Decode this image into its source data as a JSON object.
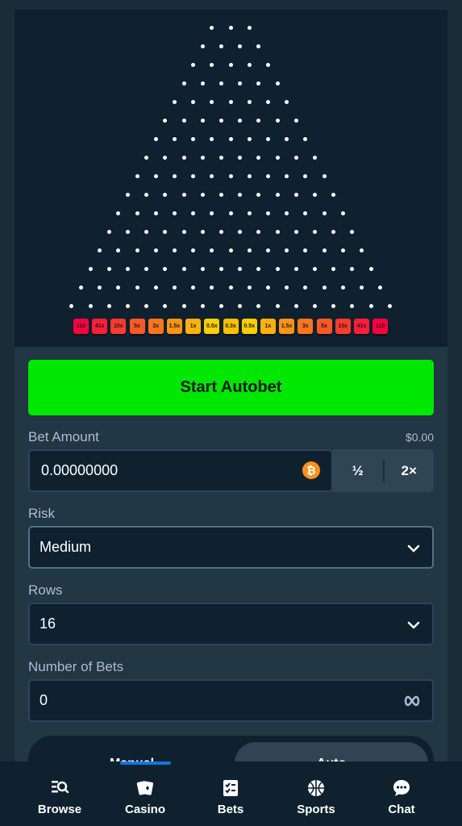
{
  "plinko": {
    "rows": 16,
    "multipliers": [
      "110",
      "41x",
      "10x",
      "5x",
      "3x",
      "1.5x",
      "1x",
      "0.5x",
      "0.3x",
      "0.5x",
      "1x",
      "1.5x",
      "3x",
      "5x",
      "10x",
      "41x",
      "110"
    ],
    "slot_colors": [
      "#ff003f",
      "#ff1d37",
      "#ff3a2e",
      "#fe5825",
      "#fe751c",
      "#fe9314",
      "#feb00b",
      "#fecd03",
      "#ffc000",
      "#fecd03",
      "#feb00b",
      "#fe9314",
      "#fe751c",
      "#fe5825",
      "#ff3a2e",
      "#ff1d37",
      "#ff003f"
    ]
  },
  "start_button": {
    "label": "Start Autobet"
  },
  "bet_amount": {
    "label": "Bet Amount",
    "usd_value": "$0.00",
    "value": "0.00000000",
    "half_label": "½",
    "double_label": "2×"
  },
  "risk": {
    "label": "Risk",
    "value": "Medium"
  },
  "rows_select": {
    "label": "Rows",
    "value": "16"
  },
  "number_of_bets": {
    "label": "Number of Bets",
    "value": "0"
  },
  "mode_tabs": {
    "manual": "Manual",
    "auto": "Auto"
  },
  "nav": {
    "items": [
      {
        "label": "Browse",
        "icon": "browse-icon"
      },
      {
        "label": "Casino",
        "icon": "casino-icon"
      },
      {
        "label": "Bets",
        "icon": "bets-icon"
      },
      {
        "label": "Sports",
        "icon": "sports-icon"
      },
      {
        "label": "Chat",
        "icon": "chat-icon"
      }
    ]
  },
  "colors": {
    "accent_green": "#00e701",
    "panel": "#213743",
    "board": "#0f212e",
    "nav_active": "#1475e1"
  }
}
